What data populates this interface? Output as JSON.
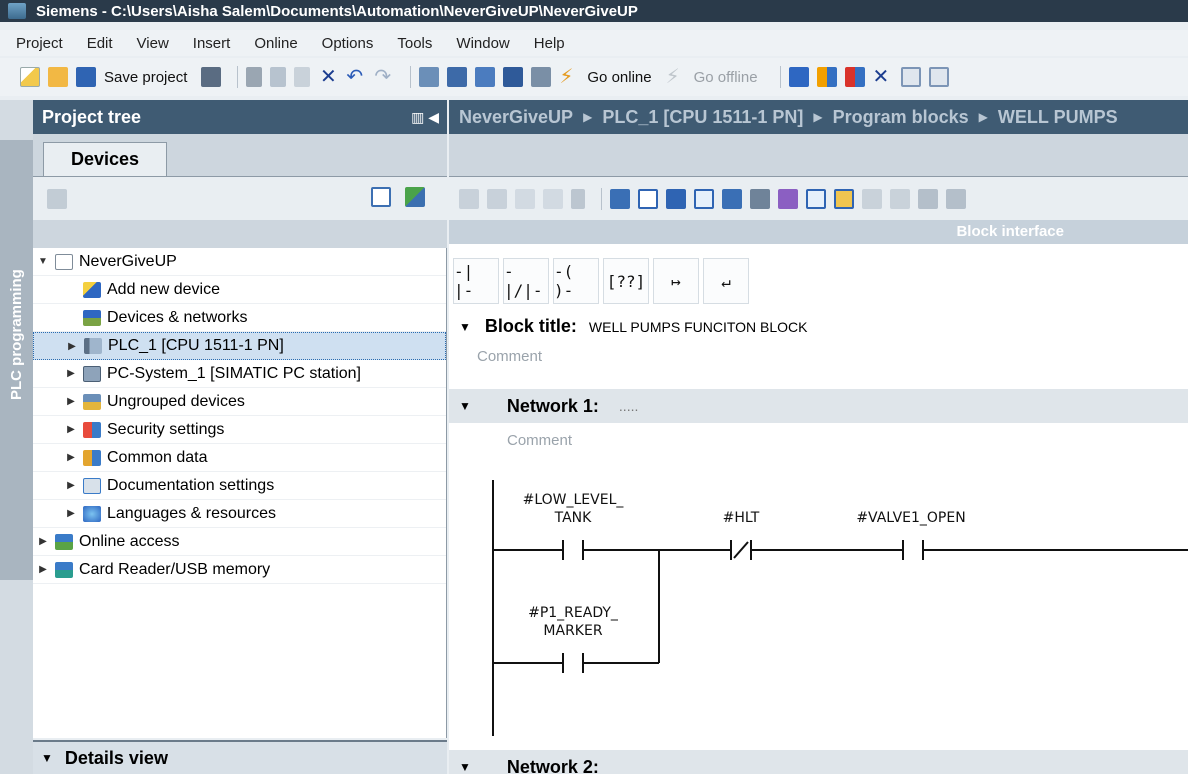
{
  "window": {
    "title": "Siemens  -  C:\\Users\\Aisha Salem\\Documents\\Automation\\NeverGiveUP\\NeverGiveUP"
  },
  "menu": [
    "Project",
    "Edit",
    "View",
    "Insert",
    "Online",
    "Options",
    "Tools",
    "Window",
    "Help"
  ],
  "toolbar": {
    "save_label": "Save project",
    "go_online": "Go online",
    "go_offline": "Go offline"
  },
  "left_strip": {
    "tab_label": "PLC programming"
  },
  "project_tree": {
    "header": "Project tree",
    "tab": "Devices",
    "items": [
      {
        "label": "NeverGiveUP",
        "icon": "project-icon",
        "level": 0,
        "expanded": true
      },
      {
        "label": "Add new device",
        "icon": "add-device-icon",
        "level": 1
      },
      {
        "label": "Devices & networks",
        "icon": "network-icon",
        "level": 1
      },
      {
        "label": "PLC_1 [CPU 1511-1 PN]",
        "icon": "plc-icon",
        "level": 1,
        "selected": true
      },
      {
        "label": "PC-System_1 [SIMATIC PC station]",
        "icon": "pc-icon",
        "level": 1
      },
      {
        "label": "Ungrouped devices",
        "icon": "ungrouped-icon",
        "level": 1
      },
      {
        "label": "Security settings",
        "icon": "security-icon",
        "level": 1
      },
      {
        "label": "Common data",
        "icon": "common-data-icon",
        "level": 1
      },
      {
        "label": "Documentation settings",
        "icon": "documentation-icon",
        "level": 1
      },
      {
        "label": "Languages & resources",
        "icon": "languages-icon",
        "level": 1
      },
      {
        "label": "Online access",
        "icon": "online-access-icon",
        "level": 0
      },
      {
        "label": "Card Reader/USB memory",
        "icon": "card-reader-icon",
        "level": 0
      }
    ],
    "details_view": "Details view"
  },
  "editor": {
    "breadcrumb": [
      "NeverGiveUP",
      "PLC_1 [CPU 1511-1 PN]",
      "Program blocks",
      "WELL PUMPS"
    ],
    "block_interface": "Block interface",
    "block_title_label": "Block title:",
    "block_title_value": "WELL PUMPS FUNCITON BLOCK",
    "comment_placeholder": "Comment",
    "network1": {
      "title": "Network 1:",
      "dots": ".....",
      "comment": "Comment"
    },
    "network2": {
      "title": "Network 2:"
    },
    "ladder": {
      "contact1_line1": "#LOW_LEVEL_",
      "contact1_line2": "TANK",
      "contact2": "#HLT",
      "contact3": "#VALVE1_OPEN",
      "contact4_line1": "#P1_READY_",
      "contact4_line2": "MARKER"
    },
    "lad_buttons": [
      "-| |-",
      "-|/|-",
      "-( )-",
      "[??]",
      "↦",
      "↵"
    ]
  },
  "colors": {
    "title_bg": "#2a3a4a",
    "panel_header": "#3f5b73",
    "selection": "#cfe0f1"
  }
}
